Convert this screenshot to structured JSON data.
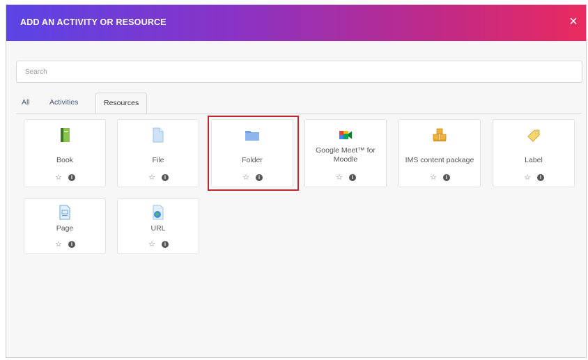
{
  "dialog": {
    "title": "ADD AN ACTIVITY OR RESOURCE",
    "close_icon": "close-icon",
    "close_glyph": "×",
    "gradient_colors": [
      "#5b44e6",
      "#ea2a5f"
    ]
  },
  "search": {
    "placeholder": "Search",
    "value": ""
  },
  "tabs": [
    {
      "label": "All",
      "active": false
    },
    {
      "label": "Activities",
      "active": false
    },
    {
      "label": "Resources",
      "active": true
    }
  ],
  "items": [
    {
      "name": "Book",
      "icon": "book-icon"
    },
    {
      "name": "File",
      "icon": "file-icon"
    },
    {
      "name": "Folder",
      "icon": "folder-icon",
      "highlighted": true
    },
    {
      "name": "Google Meet™ for Moodle",
      "icon": "google-meet-icon"
    },
    {
      "name": "IMS content package",
      "icon": "ims-package-icon"
    },
    {
      "name": "Label",
      "icon": "label-icon"
    },
    {
      "name": "Page",
      "icon": "page-icon"
    },
    {
      "name": "URL",
      "icon": "url-icon"
    }
  ],
  "card_actions": {
    "star_icon": "star-outline-icon",
    "star_glyph": "☆",
    "info_icon": "info-icon",
    "info_glyph": "i"
  },
  "highlight_color": "#c0262d"
}
